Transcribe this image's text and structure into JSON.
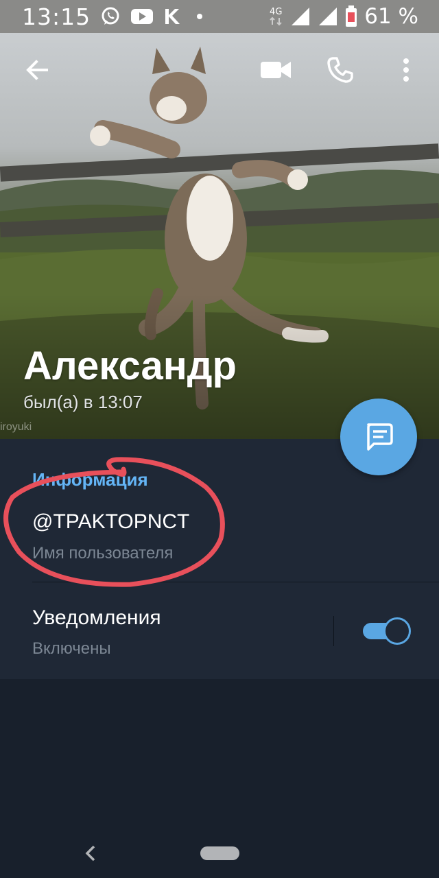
{
  "status_bar": {
    "time": "13:15",
    "network_type": "4G",
    "battery_percent": "61 %",
    "notification_icons": [
      "whatsapp-icon",
      "youtube-icon",
      "vk-icon",
      "dot-icon"
    ]
  },
  "toolbar": {
    "back_icon": "arrow-left-icon",
    "video_call_icon": "video-camera-icon",
    "call_icon": "phone-icon",
    "menu_icon": "more-vertical-icon"
  },
  "profile": {
    "name": "Александр",
    "last_seen": "был(а) в 13:07",
    "photo_credit": "iroyuki"
  },
  "fab": {
    "icon": "message-icon"
  },
  "info": {
    "section_title": "Информация",
    "username": "@TPAKTOPNCT",
    "username_caption": "Имя пользователя",
    "notifications_label": "Уведомления",
    "notifications_status": "Включены",
    "notifications_enabled": true
  },
  "colors": {
    "accent": "#5aa7e3",
    "section_title": "#64b5f6",
    "panel_bg": "#1f2836",
    "page_bg": "#18202c",
    "annotation": "#e8505b"
  },
  "nav_bar": {
    "back_icon": "chevron-left-icon",
    "home_icon": "home-pill"
  }
}
